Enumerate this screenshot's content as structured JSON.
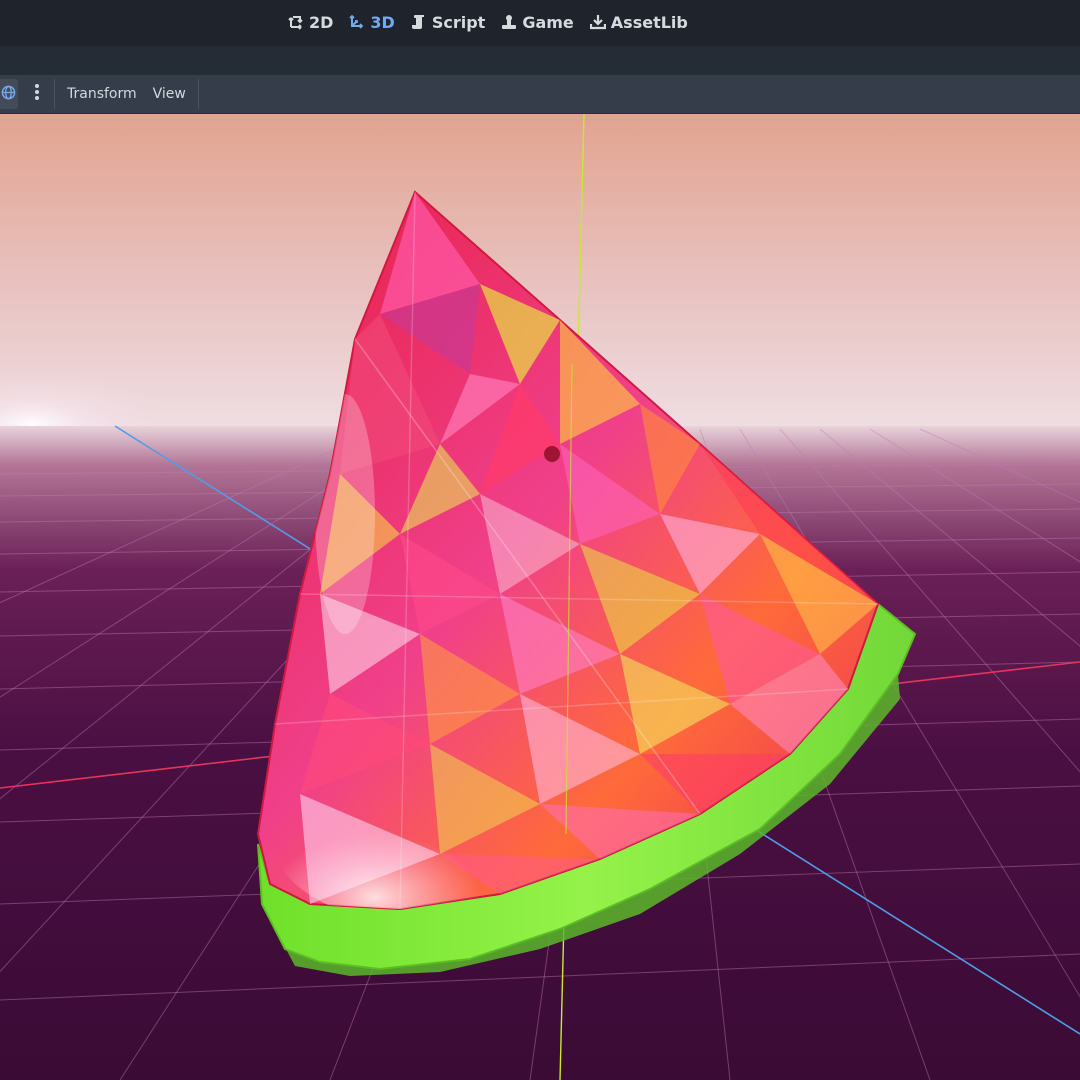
{
  "workspaces": [
    {
      "label": "2D",
      "icon": "2d-icon",
      "active": false
    },
    {
      "label": "3D",
      "icon": "3d-icon",
      "active": true
    },
    {
      "label": "Script",
      "icon": "script-icon",
      "active": false
    },
    {
      "label": "Game",
      "icon": "game-icon",
      "active": false
    },
    {
      "label": "AssetLib",
      "icon": "download-icon",
      "active": false
    }
  ],
  "toolbar": {
    "globe_icon": "globe-icon",
    "more_icon": "vertical-ellipsis-icon",
    "transform_label": "Transform",
    "view_label": "View"
  },
  "colors": {
    "active_accent": "#74a8ef",
    "x_axis": "#e8345c",
    "y_axis": "#c8e832",
    "z_axis": "#4f9ee8",
    "grid": "#c27bb5",
    "floor": "#3a0a36",
    "sky_top": "#e3a792",
    "sky_horizon": "#f0e0e4",
    "rind": "#8af03a",
    "flesh": "#ec2a58"
  }
}
